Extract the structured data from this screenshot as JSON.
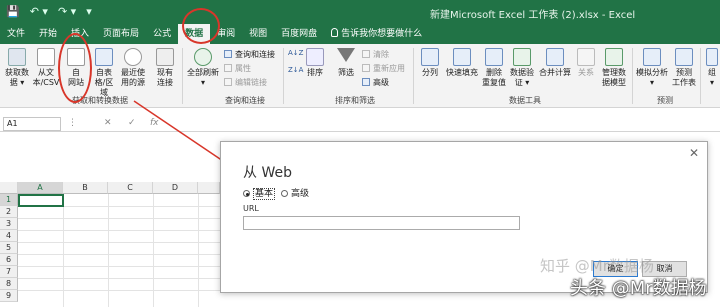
{
  "titlebar": {
    "title": "新建Microsoft Excel 工作表 (2).xlsx  -  Excel",
    "qat": [
      "💾",
      "↶ ▾",
      "↷ ▾",
      "▾"
    ]
  },
  "tabs": [
    "文件",
    "开始",
    "插入",
    "页面布局",
    "公式",
    "数据",
    "审阅",
    "视图",
    "百度网盘",
    "告诉我你想要做什么"
  ],
  "ribbon": {
    "get_data": [
      "获取数",
      "据 ▾"
    ],
    "from_text": [
      "从文",
      "本/CSV"
    ],
    "from_web": [
      "自",
      "网站"
    ],
    "from_table": [
      "自表",
      "格/区域"
    ],
    "recent": [
      "最近使",
      "用的源"
    ],
    "existing": [
      "现有",
      "连接"
    ],
    "group1": "获取和转换数据",
    "refresh_all": [
      "全部刷新",
      "▾"
    ],
    "queries": "查询和连接",
    "properties": "属性",
    "edit_links": "编辑链接",
    "group2": "查询和连接",
    "sort": "排序",
    "filter": "筛选",
    "clear": "清除",
    "reapply": "重新应用",
    "advanced": "高级",
    "group3": "排序和筛选",
    "split": "分列",
    "flash_fill": "快速填充",
    "remove_dup": [
      "删除",
      "重复值"
    ],
    "validate": [
      "数据验",
      "证 ▾"
    ],
    "consolidate": "合并计算",
    "relations": "关系",
    "data_model": [
      "管理数",
      "据模型"
    ],
    "group4": "数据工具",
    "what_if": [
      "模拟分析",
      "▾"
    ],
    "forecast": [
      "预测",
      "工作表"
    ],
    "group5": "预测",
    "group_last": [
      "组",
      "▾"
    ]
  },
  "formula_bar": {
    "name_box": "A1",
    "symbols": [
      "⋮",
      "✕",
      "✓",
      "fx"
    ]
  },
  "grid": {
    "columns": [
      "A",
      "B",
      "C",
      "D"
    ],
    "rows": [
      "1",
      "2",
      "3",
      "4",
      "5",
      "6",
      "7",
      "8",
      "9"
    ]
  },
  "dialog": {
    "title": "从 Web",
    "close": "✕",
    "option_basic": "基本",
    "option_advanced": "高级",
    "url_label": "URL",
    "url_value": "",
    "ok": "确定",
    "cancel": "取消"
  },
  "watermarks": [
    "知乎 @Mr数据杨",
    "头条 @Mr数据杨"
  ],
  "colors": {
    "excel_green": "#217346",
    "annotation_red": "#d8362a"
  }
}
